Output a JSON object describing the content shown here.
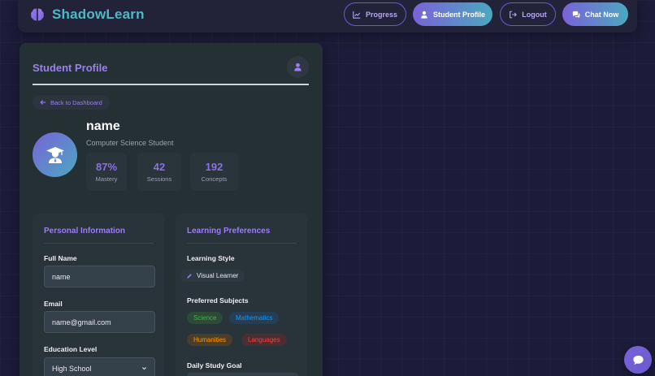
{
  "app": {
    "name": "ShadowLearn"
  },
  "nav": {
    "progress": "Progress",
    "student_profile": "Student Profile",
    "logout": "Logout",
    "chat_now": "Chat Now"
  },
  "card": {
    "title": "Student Profile",
    "back_label": "Back to Dashboard"
  },
  "profile": {
    "name": "name",
    "role": "Computer Science Student",
    "stats": [
      {
        "value": "87%",
        "label": "Mastery"
      },
      {
        "value": "42",
        "label": "Sessions"
      },
      {
        "value": "192",
        "label": "Concepts"
      }
    ]
  },
  "personal": {
    "title": "Personal Information",
    "full_name_label": "Full Name",
    "full_name_value": "name",
    "email_label": "Email",
    "email_value": "name@gmail.com",
    "education_label": "Education Level",
    "education_value": "High School"
  },
  "preferences": {
    "title": "Learning Preferences",
    "style_label": "Learning Style",
    "style_value": "Visual Learner",
    "subjects_label": "Preferred Subjects",
    "subjects": [
      {
        "label": "Science",
        "color": "#4caf50",
        "bg": "#2c4a36"
      },
      {
        "label": "Mathematics",
        "color": "#2196f3",
        "bg": "#233e55"
      },
      {
        "label": "Humanities",
        "color": "#ff9800",
        "bg": "#4a3d2a"
      },
      {
        "label": "Languages",
        "color": "#f44336",
        "bg": "#4a2e32"
      }
    ],
    "goal_label": "Daily Study Goal"
  },
  "colors": {
    "accent_purple": "#9b7ef2",
    "accent_teal": "#4fb8c4",
    "background": "#1c1c3a",
    "card": "#253035"
  },
  "icons": {
    "brand": "brain-icon",
    "progress": "chart-line-icon",
    "profile": "user-icon",
    "logout": "logout-icon",
    "chat": "chat-icon",
    "avatar": "graduate-icon",
    "style": "pencil-icon",
    "fab": "chat-bubble-icon"
  }
}
